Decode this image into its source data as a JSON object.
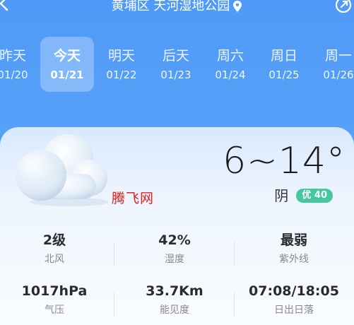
{
  "header": {
    "location": "黄埔区 天河湿地公园"
  },
  "days": [
    {
      "name": "昨天",
      "date": "01/20"
    },
    {
      "name": "今天",
      "date": "01/21"
    },
    {
      "name": "明天",
      "date": "01/22"
    },
    {
      "name": "后天",
      "date": "01/23"
    },
    {
      "name": "周六",
      "date": "01/24"
    },
    {
      "name": "周日",
      "date": "01/25"
    },
    {
      "name": "周一",
      "date": "01/26"
    }
  ],
  "selected_day": "今天",
  "weather": {
    "temperature": "6~14°",
    "condition": "阴",
    "aqi_badge": "优 40",
    "icon": "cloud-icon",
    "watermark": "腾飞网"
  },
  "stats": [
    {
      "value": "2级",
      "label": "北风"
    },
    {
      "value": "42%",
      "label": "湿度"
    },
    {
      "value": "最弱",
      "label": "紫外线"
    },
    {
      "value": "1017hPa",
      "label": "气压"
    },
    {
      "value": "33.7Km",
      "label": "能见度"
    },
    {
      "value": "07:08/18:05",
      "label": "日出日落"
    }
  ],
  "colors": {
    "background_top": "#4f9af8",
    "aqi_good": "#45c7a0",
    "watermark": "#ea1c1c",
    "text_dark": "#1a1a1a"
  }
}
